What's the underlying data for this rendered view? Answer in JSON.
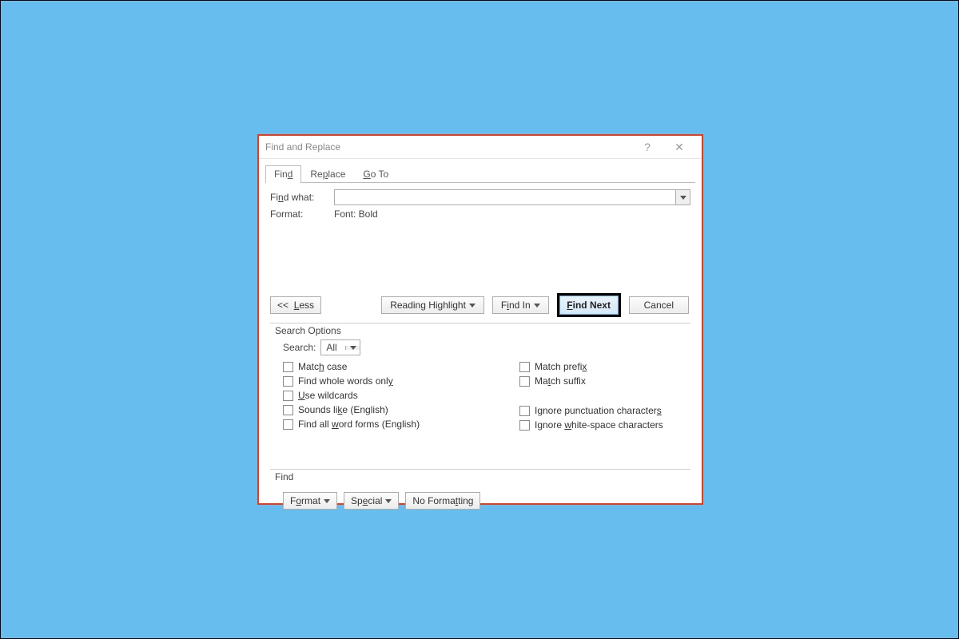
{
  "dialog": {
    "title": "Find and Replace",
    "help_symbol": "?",
    "close_symbol": "✕",
    "tabs": {
      "find": "Find",
      "replace": "Replace",
      "goto": "Go To"
    },
    "find_what_label": "Find what:",
    "find_what_value": "",
    "format_label": "Format:",
    "format_value": "Font: Bold",
    "buttons": {
      "less": "<<  Less",
      "reading_highlight": "Reading Highlight",
      "find_in": "Find In",
      "find_next": "Find Next",
      "cancel": "Cancel"
    },
    "search_options": {
      "legend": "Search Options",
      "search_label": "Search:",
      "search_value": "All",
      "left": {
        "match_case": "Match case",
        "whole_words": "Find whole words only",
        "wildcards": "Use wildcards",
        "sounds_like": "Sounds like (English)",
        "word_forms": "Find all word forms (English)"
      },
      "right": {
        "match_prefix": "Match prefix",
        "match_suffix": "Match suffix",
        "ignore_punct": "Ignore punctuation characters",
        "ignore_ws": "Ignore white-space characters"
      }
    },
    "find_section": {
      "legend": "Find",
      "format": "Format",
      "special": "Special",
      "no_formatting": "No Formatting"
    }
  }
}
